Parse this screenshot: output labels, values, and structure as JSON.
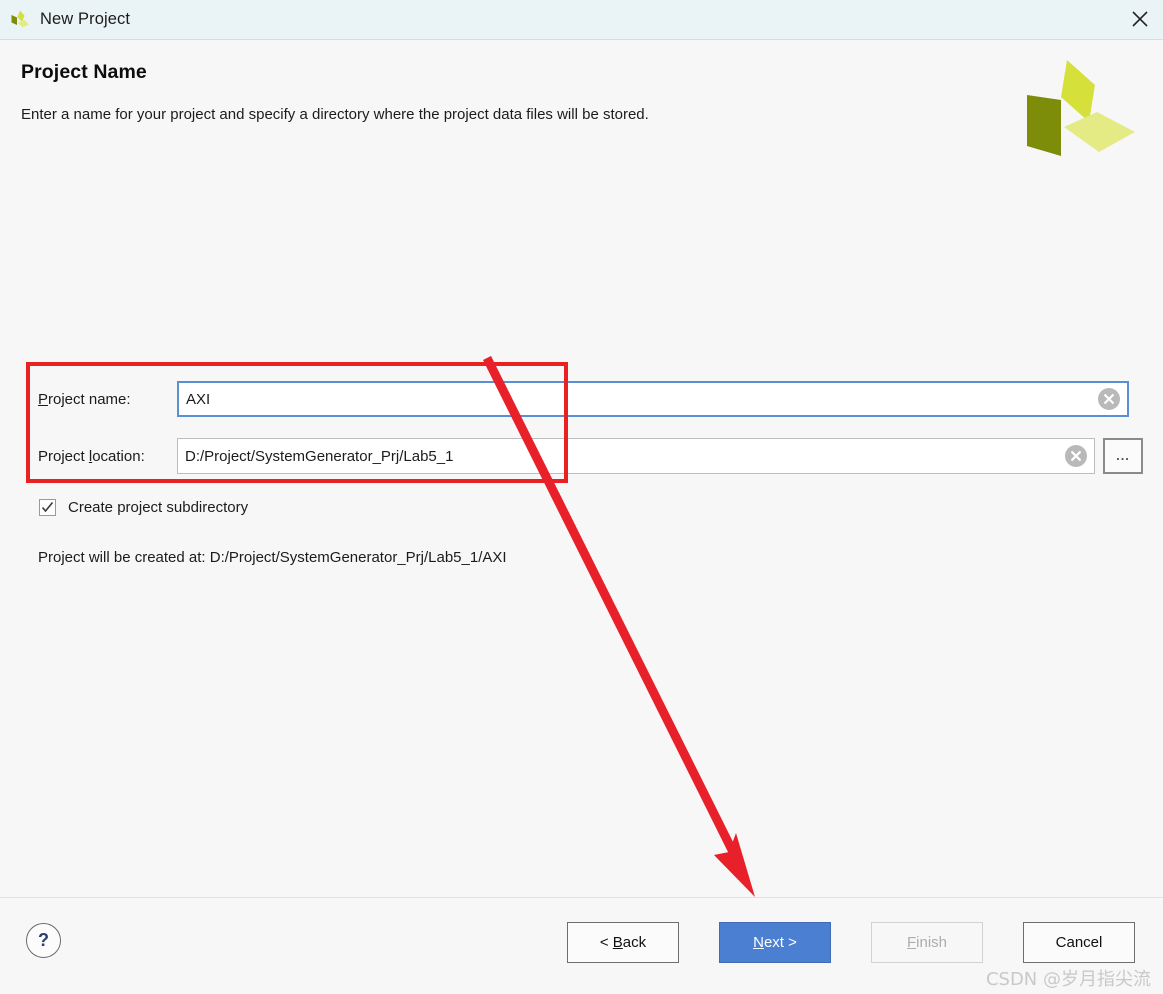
{
  "window": {
    "title": "New Project",
    "app_icon": "xilinx-logo-icon",
    "close_icon": "close-icon"
  },
  "header": {
    "title": "Project Name",
    "subtitle": "Enter a name for your project and specify a directory where the project data files will be stored.",
    "logo": "xilinx-logo"
  },
  "form": {
    "project_name": {
      "label_prefix": "P",
      "label_rest": "roject name:",
      "label_full": "Project name:",
      "value": "AXI",
      "placeholder": "",
      "clear_icon": "clear-circle-icon"
    },
    "project_location": {
      "label_prefix": "Project ",
      "label_mnemonic": "l",
      "label_rest": "ocation:",
      "label_full": "Project location:",
      "value": "D:/Project/SystemGenerator_Prj/Lab5_1",
      "placeholder": "",
      "clear_icon": "clear-circle-icon",
      "browse_label": "...",
      "browse_icon": "ellipsis-icon"
    },
    "create_subdirectory": {
      "label": "Create project subdirectory",
      "checked": true,
      "check_icon": "checkmark-icon"
    },
    "created_at": "Project will be created at: D:/Project/SystemGenerator_Prj/Lab5_1/AXI"
  },
  "annotations": {
    "highlight_box_color": "#e82121",
    "arrow_color": "#e8202a",
    "arrow_from": "487,358",
    "arrow_to": "755,897"
  },
  "footer": {
    "help_label": "?",
    "help_icon": "help-circle-icon",
    "buttons": [
      {
        "id": "back",
        "prefix": "< ",
        "mnemonic": "B",
        "rest": "ack",
        "label": "< Back",
        "state": "normal"
      },
      {
        "id": "next",
        "prefix": "",
        "mnemonic": "N",
        "rest": "ext >",
        "label": "Next >",
        "state": "primary"
      },
      {
        "id": "finish",
        "prefix": "",
        "mnemonic": "F",
        "rest": "inish",
        "label": "Finish",
        "state": "disabled"
      },
      {
        "id": "cancel",
        "prefix": "",
        "mnemonic": "",
        "rest": "Cancel",
        "label": "Cancel",
        "state": "normal"
      }
    ]
  },
  "watermark": "CSDN @岁月指尖流",
  "colors": {
    "titlebar_bg": "#eaf3f6",
    "body_bg": "#f7f7f7",
    "primary_button": "#4b7fd1",
    "focus_border": "#5b8fd4",
    "annotation_red": "#e82121",
    "logo_dark": "#7d8c09",
    "logo_mid": "#d6e03a",
    "logo_light": "#e4eb85"
  }
}
